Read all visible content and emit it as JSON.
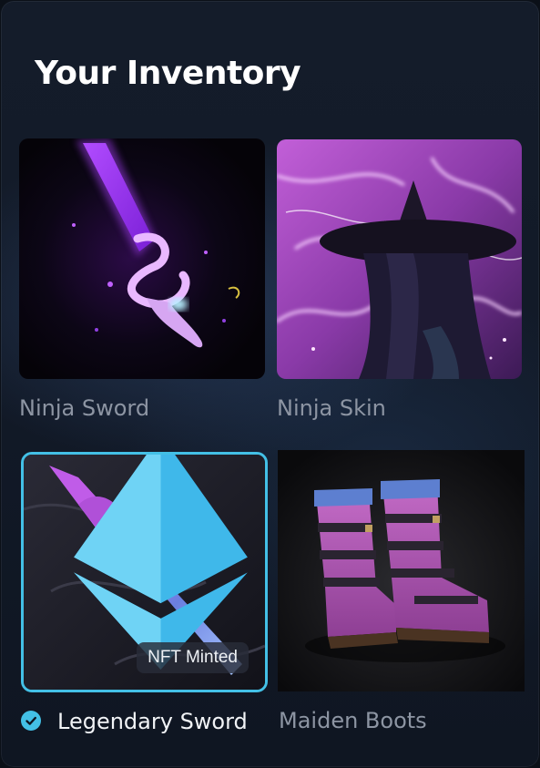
{
  "header": {
    "title": "Your Inventory"
  },
  "items": [
    {
      "name": "Ninja Sword",
      "selected": false,
      "minted": false
    },
    {
      "name": "Ninja Skin",
      "selected": false,
      "minted": false
    },
    {
      "name": "Legendary Sword",
      "selected": true,
      "minted": true,
      "badge": "NFT Minted",
      "chain_icon": "ethereum-icon"
    },
    {
      "name": "Maiden Boots",
      "selected": false,
      "minted": false
    }
  ],
  "colors": {
    "selected_accent": "#43c0e6",
    "label_default": "#8d95a3",
    "label_selected": "#f1f3f6"
  }
}
